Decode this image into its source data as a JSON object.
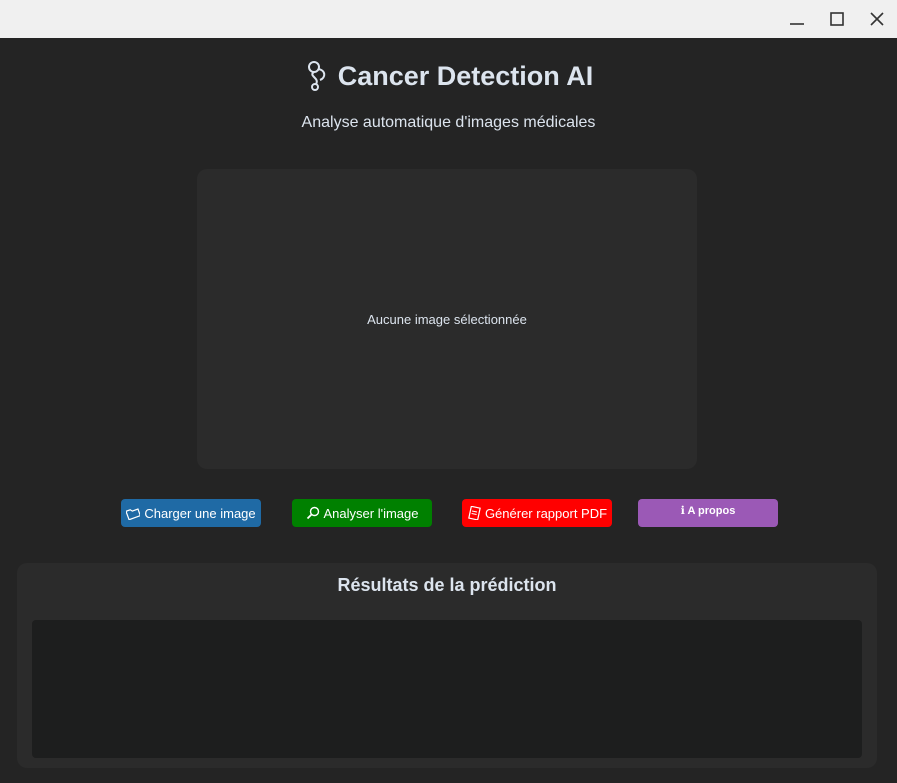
{
  "window": {
    "controls": [
      "minimize-icon",
      "maximize-icon",
      "close-icon"
    ]
  },
  "header": {
    "title": "Cancer Detection AI",
    "logo_icon": "stethoscope-icon",
    "subtitle": "Analyse automatique d'images médicales"
  },
  "preview": {
    "placeholder": "Aucune image sélectionnée"
  },
  "actions": {
    "load": {
      "label": "Charger une image",
      "icon": "folder-icon",
      "color": "#1f6aa5"
    },
    "analyze": {
      "label": "Analyser l'image",
      "icon": "search-icon",
      "color": "#008000"
    },
    "pdf": {
      "label": "Générer rapport PDF",
      "icon": "document-icon",
      "color": "#ff0000"
    },
    "about": {
      "label": "ℹ A propos",
      "color": "#9b59b6"
    }
  },
  "results": {
    "title": "Résultats de la prédiction",
    "content": ""
  },
  "theme": {
    "background": "#242424",
    "panel": "#2b2b2b",
    "text": "#dce4ee"
  }
}
